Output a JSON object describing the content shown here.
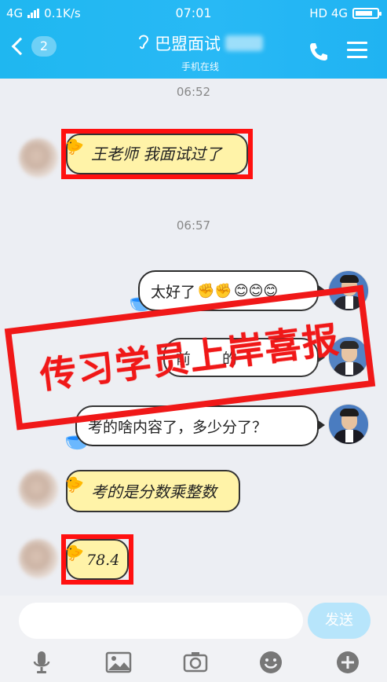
{
  "status_bar": {
    "network": "4G",
    "speed": "0.1K/s",
    "time": "07:01",
    "right_network": "HD 4G",
    "battery_level": 0.7
  },
  "header": {
    "unread_count": "2",
    "title": "巴盟面试",
    "subtitle": "手机在线"
  },
  "messages": {
    "ts1": "06:52",
    "msg1": "王老师 我面试过了",
    "ts2": "06:57",
    "msg2": "太好了",
    "msg3": "前",
    "msg3b": "的",
    "msg4": "考的啥内容了，多少分了？",
    "msg5": "考的是分数乘整数",
    "msg6": "78.4"
  },
  "stamp": {
    "text": "传习学员上岸喜报"
  },
  "input": {
    "placeholder": "",
    "send_label": "发送"
  },
  "colors": {
    "header": "#24b6f2",
    "stamp_red": "#f01818",
    "bubble_yellow": "#fff3a8"
  }
}
